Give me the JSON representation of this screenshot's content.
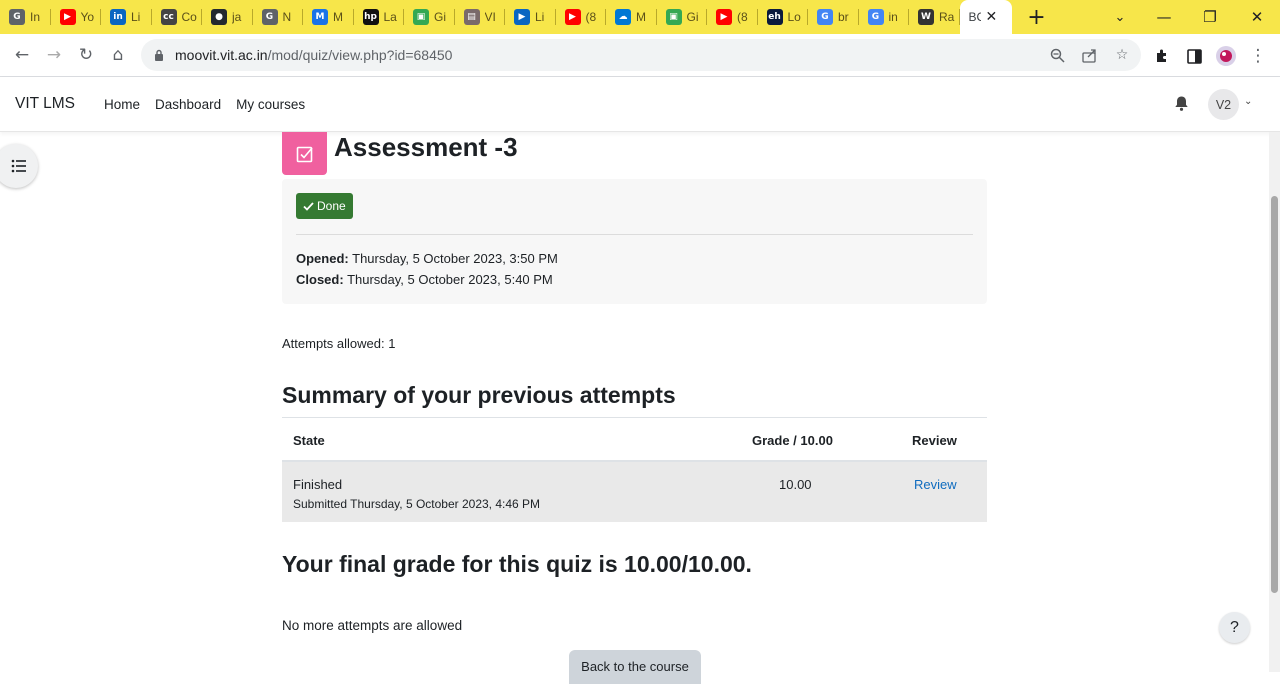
{
  "browser": {
    "tabs": [
      {
        "title": "In",
        "color": "#5f6368",
        "glyph": "G"
      },
      {
        "title": "Yo",
        "color": "#ff0000",
        "glyph": "▶"
      },
      {
        "title": "Li",
        "color": "#0a66c2",
        "glyph": "in"
      },
      {
        "title": "Co",
        "color": "#444444",
        "glyph": "cc"
      },
      {
        "title": "ja",
        "color": "#24292f",
        "glyph": "●"
      },
      {
        "title": "N",
        "color": "#5f6368",
        "glyph": "G"
      },
      {
        "title": "M",
        "color": "#1a73e8",
        "glyph": "M"
      },
      {
        "title": "La",
        "color": "#111111",
        "glyph": "hp"
      },
      {
        "title": "Gi",
        "color": "#34a853",
        "glyph": "▣"
      },
      {
        "title": "VI",
        "color": "#7a6a6a",
        "glyph": "▤"
      },
      {
        "title": "Li",
        "color": "#0a66c2",
        "glyph": "▶"
      },
      {
        "title": "(8",
        "color": "#ff0000",
        "glyph": "▶"
      },
      {
        "title": "M",
        "color": "#0078d4",
        "glyph": "☁"
      },
      {
        "title": "Gi",
        "color": "#34a853",
        "glyph": "▣"
      },
      {
        "title": "(8",
        "color": "#ff0000",
        "glyph": "▶"
      },
      {
        "title": "Lo",
        "color": "#0b1a3d",
        "glyph": "eh"
      },
      {
        "title": "br",
        "color": "#4285f4",
        "glyph": "G"
      },
      {
        "title": "in",
        "color": "#4285f4",
        "glyph": "G"
      },
      {
        "title": "Ra",
        "color": "#333333",
        "glyph": "W"
      }
    ],
    "active_tab": {
      "title": "BC"
    },
    "url_host": "moovit.vit.ac.in",
    "url_path": "/mod/quiz/view.php?id=68450"
  },
  "navbar": {
    "brand": "VIT LMS",
    "links": [
      "Home",
      "Dashboard",
      "My courses"
    ],
    "avatar_initials": "V2"
  },
  "quiz": {
    "title": "Assessment -3",
    "done_label": "Done",
    "opened_label": "Opened:",
    "opened_value": "Thursday, 5 October 2023, 3:50 PM",
    "closed_label": "Closed:",
    "closed_value": "Thursday, 5 October 2023, 5:40 PM",
    "attempts_allowed": "Attempts allowed: 1",
    "summary_title": "Summary of your previous attempts",
    "table": {
      "headers": [
        "State",
        "Grade / 10.00",
        "Review"
      ],
      "row": {
        "state": "Finished",
        "submitted": "Submitted Thursday, 5 October 2023, 4:46 PM",
        "grade": "10.00",
        "review": "Review"
      }
    },
    "final_grade": "Your final grade for this quiz is 10.00/10.00.",
    "no_more": "No more attempts are allowed",
    "back_button": "Back to the course"
  },
  "help_label": "?"
}
